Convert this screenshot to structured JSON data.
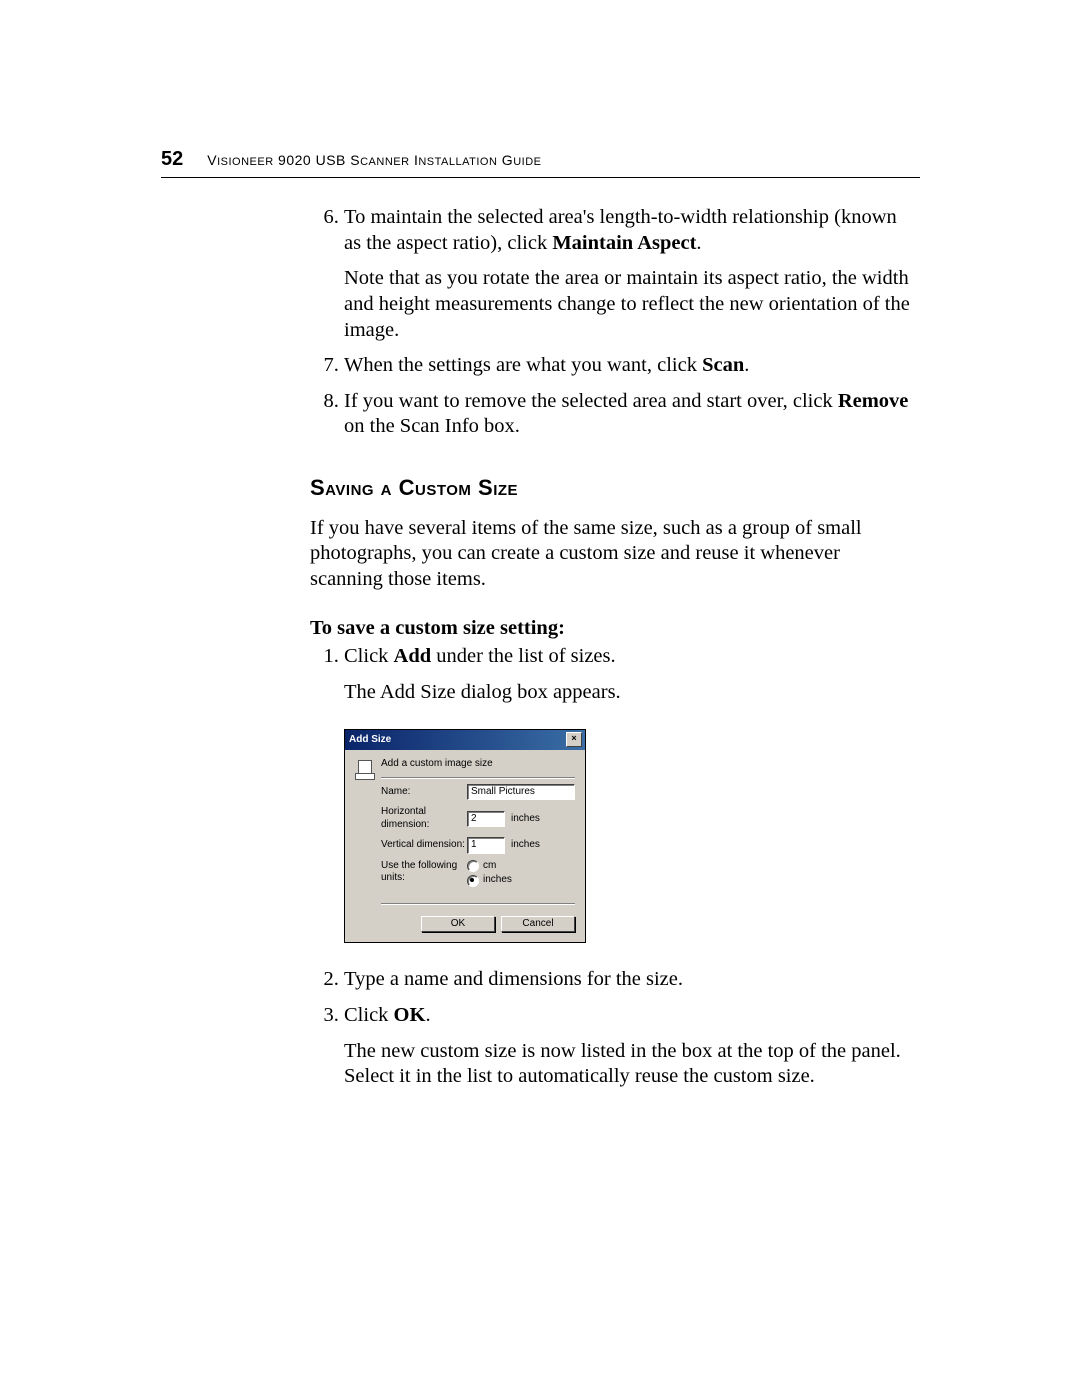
{
  "header": {
    "page_number": "52",
    "title_prefix": "V",
    "title_rest_1": "ISIONEER",
    "title_mid": " 9020 USB S",
    "title_rest_2": "CANNER",
    "title_mid2": " I",
    "title_rest_3": "NSTALLATION",
    "title_mid3": " G",
    "title_rest_4": "UIDE"
  },
  "steps_top": {
    "six_a": "To maintain the selected area's length-to-width relationship (known as the aspect ratio), click ",
    "six_bold": "Maintain Aspect",
    "six_b": ".",
    "six_note": "Note that as you rotate the area or maintain its aspect ratio, the width and height measurements change to reflect the new orientation of the image.",
    "seven_a": "When the settings are what you want, click ",
    "seven_bold": "Scan",
    "seven_b": ".",
    "eight_a": "If you want to remove the selected area and start over, click ",
    "eight_bold": "Remove",
    "eight_b": " on the Scan Info box."
  },
  "section": {
    "title": "Saving a Custom Size",
    "intro": "If you have several items of the same size, such as a group of small photographs, you can create a custom size and reuse it whenever scanning those items.",
    "subhead": "To save a custom size setting:"
  },
  "steps_bottom": {
    "one_a": "Click ",
    "one_bold": "Add",
    "one_b": " under the list of sizes.",
    "one_note": "The Add Size dialog box appears.",
    "two": "Type a name and dimensions for the size.",
    "three_a": "Click ",
    "three_bold": "OK",
    "three_b": ".",
    "three_note": "The new custom size is now listed in the box at the top of the panel. Select it in the list to automatically reuse the custom size."
  },
  "dialog": {
    "title": "Add Size",
    "close": "×",
    "instruction": "Add a custom image size",
    "name_label": "Name:",
    "name_value": "Small Pictures",
    "h_label": "Horizontal dimension:",
    "h_value": "2",
    "v_label": "Vertical dimension:",
    "v_value": "1",
    "unit_suffix": "inches",
    "units_label": "Use the following units:",
    "radio_cm": "cm",
    "radio_inches": "inches",
    "ok": "OK",
    "cancel": "Cancel"
  }
}
